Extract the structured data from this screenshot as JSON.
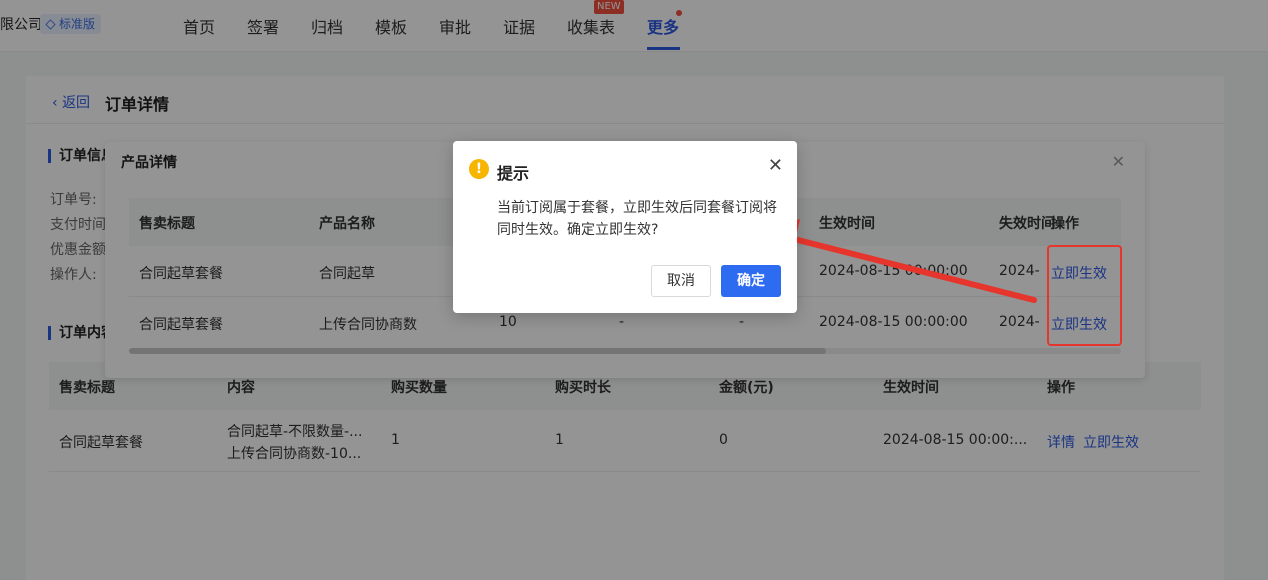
{
  "nav": {
    "company": "限公司",
    "edition": "标准版",
    "items": [
      "首页",
      "签署",
      "归档",
      "模板",
      "审批",
      "证据",
      "收集表",
      "更多"
    ],
    "new_badge": "NEW"
  },
  "page": {
    "back": "返回",
    "title": "订单详情"
  },
  "order_info": {
    "section_title": "订单信息",
    "labels": [
      "订单号:",
      "支付时间",
      "优惠金额",
      "操作人:"
    ]
  },
  "order_content": {
    "section_title": "订单内容",
    "headers": [
      "售卖标题",
      "内容",
      "购买数量",
      "购买时长",
      "金额(元)",
      "生效时间",
      "操作"
    ],
    "row": {
      "title": "合同起草套餐",
      "content_line1": "合同起草-不限数量-...",
      "content_line2": "上传合同协商数-10...",
      "quantity": "1",
      "duration": "1",
      "amount": "0",
      "effective": "2024-08-15 00:00:...",
      "action_detail": "详情",
      "action_activate": "立即生效"
    }
  },
  "product_panel": {
    "title": "产品详情",
    "headers": [
      "售卖标题",
      "产品名称",
      "生效时间",
      "失效时间",
      "操作"
    ],
    "rows": [
      {
        "title": "合同起草套餐",
        "name": "合同起草",
        "qty": "",
        "c4": "",
        "c5": "",
        "effective": "2024-08-15 00:00:00",
        "expire": "2024-",
        "action": "立即生效"
      },
      {
        "title": "合同起草套餐",
        "name": "上传合同协商数",
        "qty": "10",
        "c4": "-",
        "c5": "-",
        "effective": "2024-08-15 00:00:00",
        "expire": "2024-",
        "action": "立即生效"
      }
    ]
  },
  "dialog": {
    "title": "提示",
    "message": "当前订阅属于套餐，立即生效后同套餐订阅将同时生效。确定立即生效?",
    "cancel": "取消",
    "confirm": "确定"
  },
  "colors": {
    "accent": "#2d5be3",
    "warning": "#f7b500",
    "annotation": "#e5352c"
  }
}
